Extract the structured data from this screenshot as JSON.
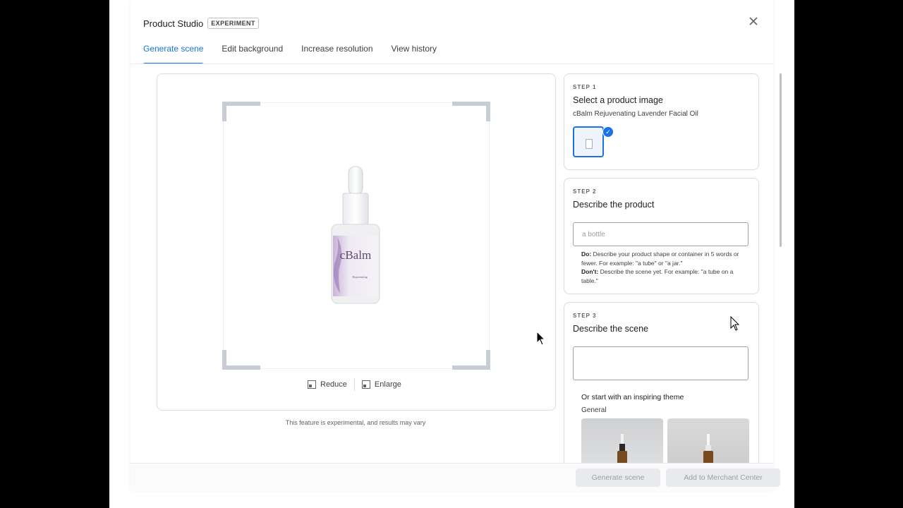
{
  "dialog": {
    "title": "Product Studio",
    "badge": "EXPERIMENT"
  },
  "tabs": [
    {
      "label": "Generate scene",
      "active": true
    },
    {
      "label": "Edit background",
      "active": false
    },
    {
      "label": "Increase resolution",
      "active": false
    },
    {
      "label": "View history",
      "active": false
    }
  ],
  "preview": {
    "brand": "cBalm",
    "reduce_label": "Reduce",
    "enlarge_label": "Enlarge",
    "footnote": "This feature is experimental, and results may vary"
  },
  "steps": {
    "step1": {
      "label": "STEP 1",
      "title": "Select a product image",
      "product_name": "cBalm Rejuvenating Lavender Facial Oil"
    },
    "step2": {
      "label": "STEP 2",
      "title": "Describe the product",
      "placeholder": "a bottle",
      "hint_do_label": "Do:",
      "hint_do": "Describe your product shape or container in 5 words or fewer. For example: \"a tube\" or \"a jar.\"",
      "hint_dont_label": "Don't:",
      "hint_dont": "Describe the scene yet. For example: \"a tube on a table.\""
    },
    "step3": {
      "label": "STEP 3",
      "title": "Describe the scene",
      "placeholder": "",
      "theme_intro": "Or start with an inspiring theme",
      "theme_category": "General"
    }
  },
  "footer": {
    "generate_label": "Generate scene",
    "add_label": "Add to Merchant Center"
  },
  "colors": {
    "accent": "#1a73e8",
    "disabled_bg": "#e8eaed",
    "disabled_text": "#9aa0a6"
  }
}
